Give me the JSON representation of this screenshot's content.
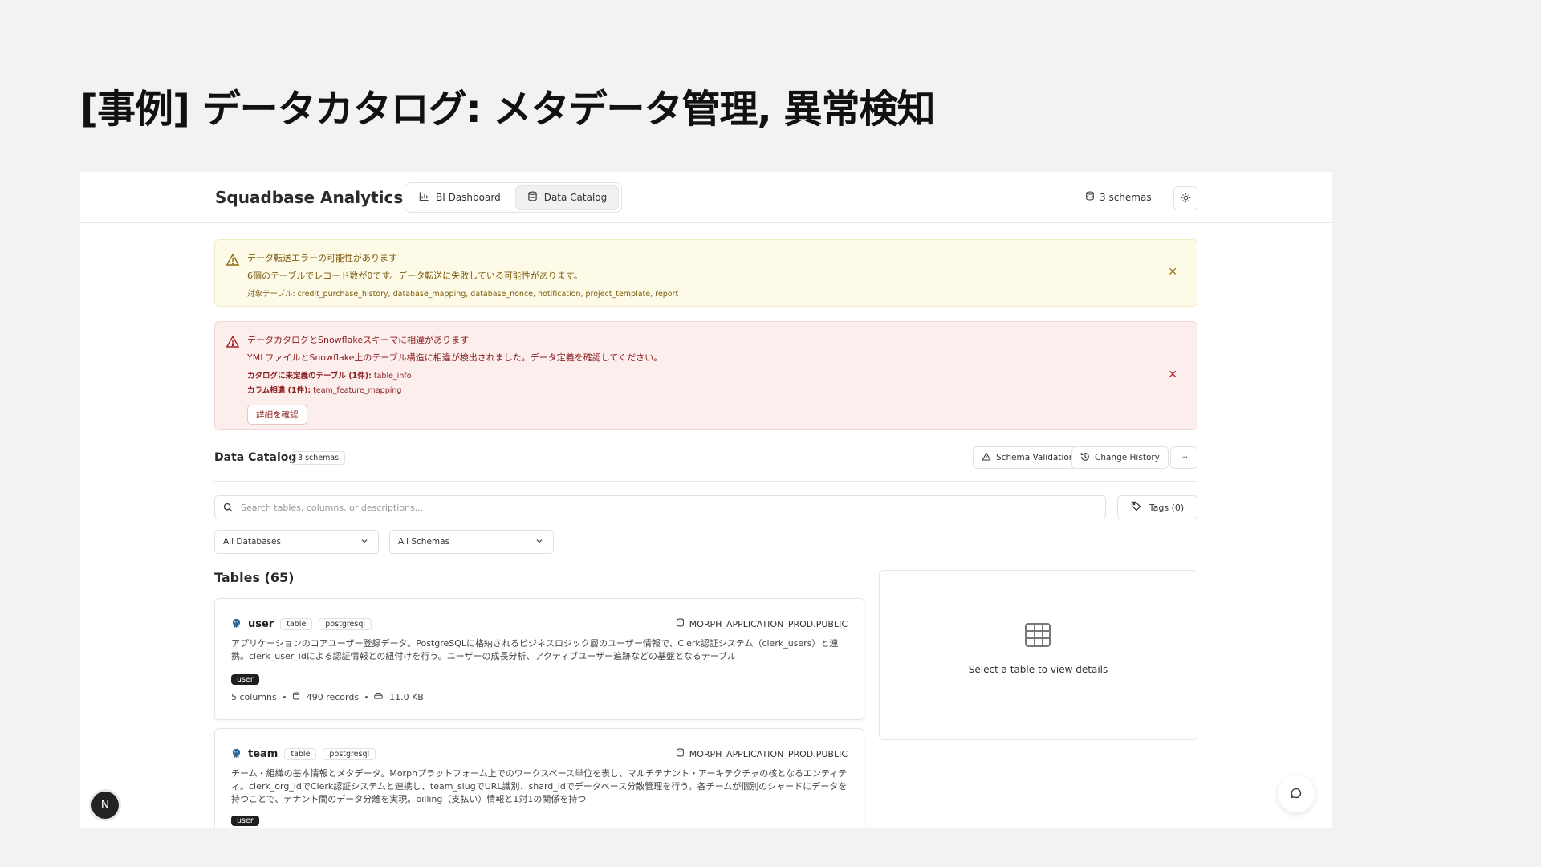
{
  "slide": {
    "title": "[事例] データカタログ: メタデータ管理, 異常検知"
  },
  "header": {
    "brand": "Squadbase Analytics",
    "tabs": [
      {
        "label": "BI Dashboard",
        "icon": "bar-chart-icon",
        "active": false
      },
      {
        "label": "Data Catalog",
        "icon": "database-icon",
        "active": true
      }
    ],
    "schemas_label": "3 schemas",
    "theme_icon": "sun-icon"
  },
  "alerts": {
    "warning": {
      "title": "データ転送エラーの可能性があります",
      "description": "6個のテーブルでレコード数が0です。データ転送に失敗している可能性があります。",
      "targets": "対象テーブル: credit_purchase_history, database_mapping, database_nonce, notification, project_template, report",
      "color": "#fdfbe8"
    },
    "error": {
      "title": "データカタログとSnowflakeスキーマに相違があります",
      "description": "YMLファイルとSnowflake上のテーブル構造に相違が検出されました。データ定義を確認してください。",
      "undefined_label": "カタログに未定義のテーブル (1件):",
      "undefined_value": "table_info",
      "column_label": "カラム相違 (1件):",
      "column_value": "team_feature_mapping",
      "button": "詳細を確認",
      "color": "#fdeeee"
    }
  },
  "catalog": {
    "title": "Data Catalog",
    "badge": "3 schemas",
    "schema_validation": "Schema Validation",
    "change_history": "Change History",
    "more": "···",
    "search_placeholder": "Search tables, columns, or descriptions...",
    "tags_button": "Tags (0)",
    "database_select": "All Databases",
    "schema_select": "All Schemas",
    "tables_title": "Tables (65)",
    "empty_hint": "Select a table to view details"
  },
  "tables": [
    {
      "name": "user",
      "type": "table",
      "source": "postgresql",
      "schema": "MORPH_APPLICATION_PROD.PUBLIC",
      "description": "アプリケーションのコアユーザー登録データ。PostgreSQLに格納されるビジネスロジック層のユーザー情報で、Clerk認証システム（clerk_users）と連携。clerk_user_idによる認証情報との紐付けを行う。ユーザーの成長分析、アクティブユーザー追跡などの基盤となるテーブル",
      "tag": "user",
      "columns": "5 columns",
      "records": "490 records",
      "size": "11.0 KB"
    },
    {
      "name": "team",
      "type": "table",
      "source": "postgresql",
      "schema": "MORPH_APPLICATION_PROD.PUBLIC",
      "description": "チーム・組織の基本情報とメタデータ。Morphプラットフォーム上でのワークスペース単位を表し、マルチテナント・アーキテクチャの核となるエンティティ。clerk_org_idでClerk認証システムと連携し、team_slugでURL識別、shard_idでデータベース分散管理を行う。各チームが個別のシャードにデータを持つことで、テナント間のデータ分離を実現。billing（支払い）情報と1対1の関係を持つ",
      "tag": "user"
    }
  ],
  "floating": {
    "avatar_letter": "N"
  }
}
